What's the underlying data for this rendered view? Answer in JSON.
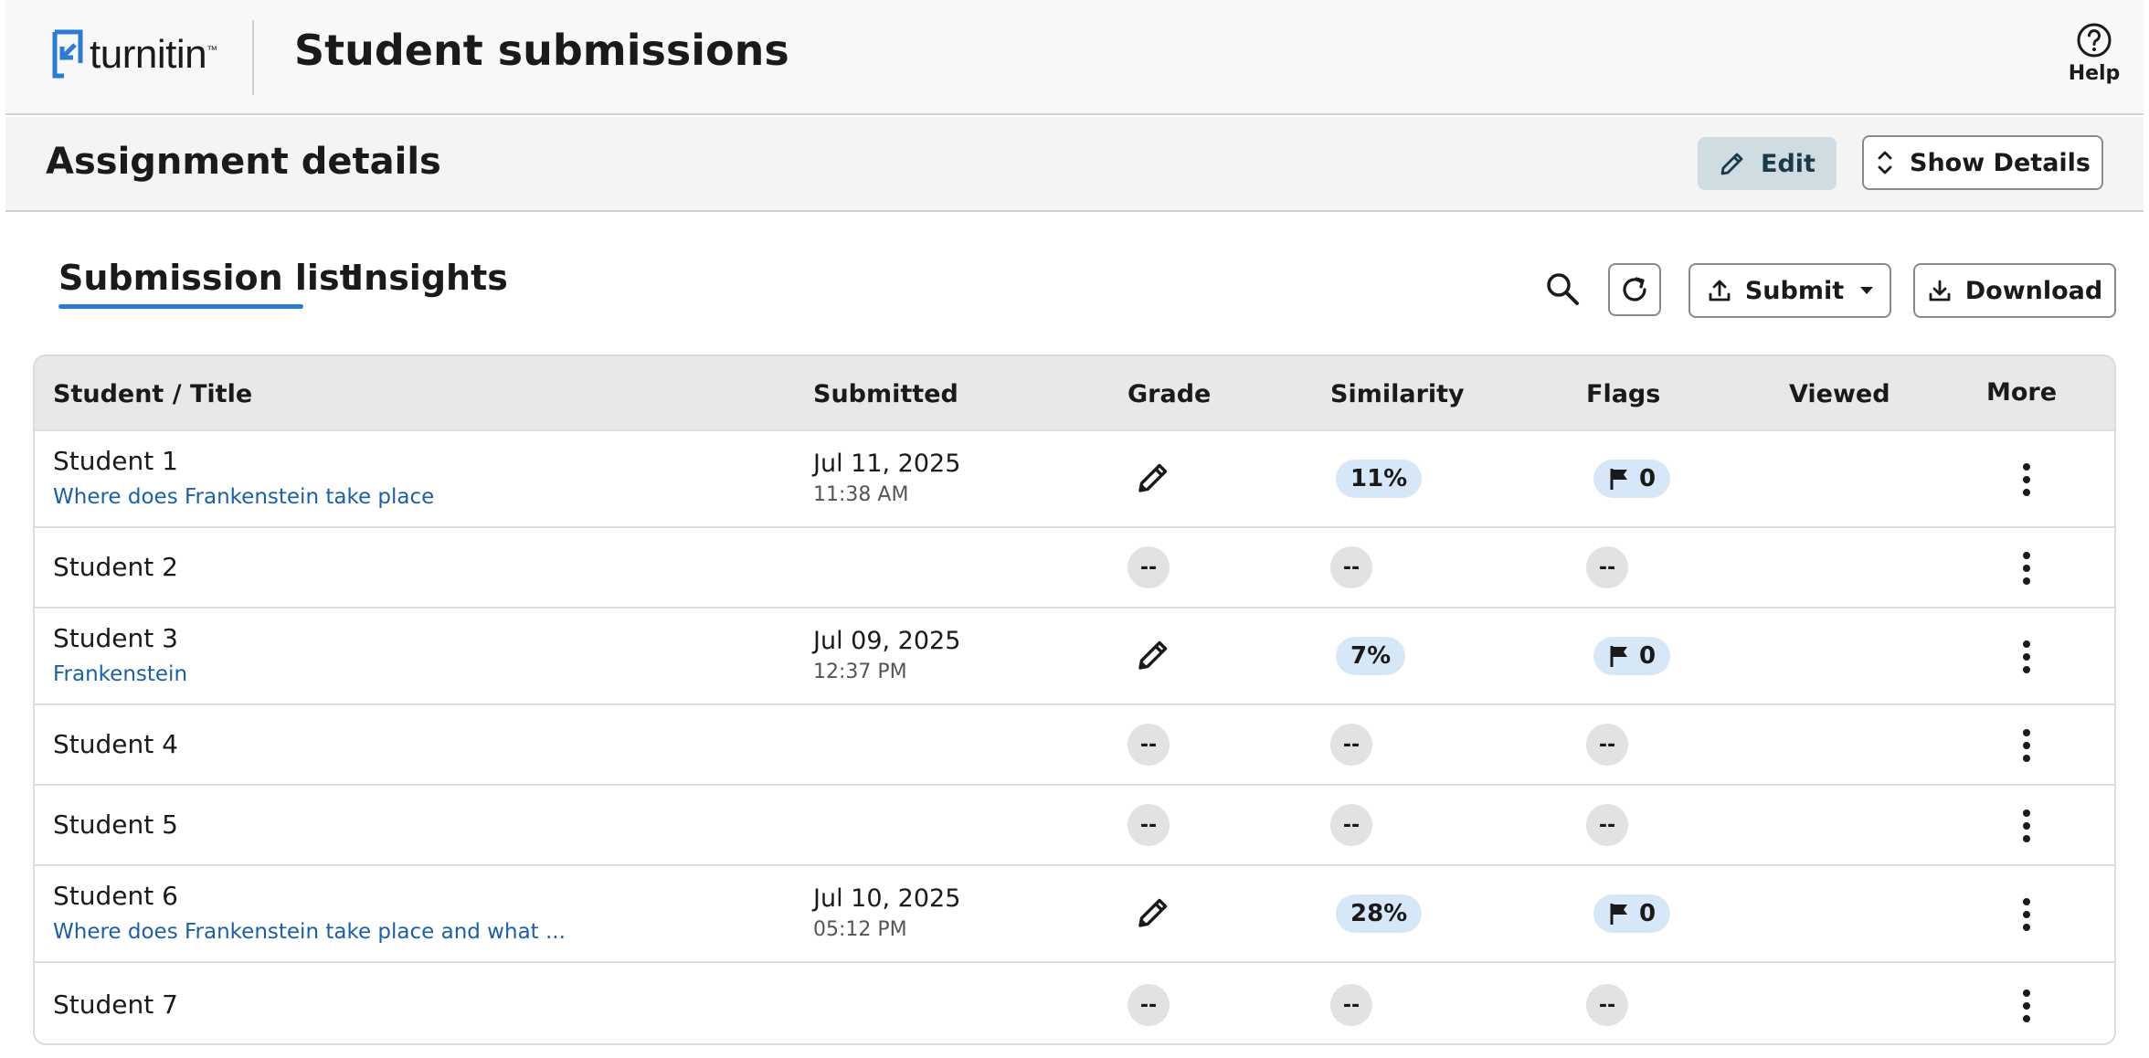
{
  "header": {
    "logo_text": "turnitin",
    "logo_tm": "™",
    "title": "Student submissions",
    "help_label": "Help"
  },
  "assignment": {
    "title": "Assignment details",
    "edit_label": "Edit",
    "show_details_label": "Show Details"
  },
  "tabs": [
    {
      "label": "Submission list",
      "active": true
    },
    {
      "label": "Insights",
      "active": false
    }
  ],
  "toolbar": {
    "submit_label": "Submit",
    "download_label": "Download"
  },
  "table": {
    "columns": [
      "Student / Title",
      "Submitted",
      "Grade",
      "Similarity",
      "Flags",
      "Viewed",
      "More"
    ],
    "empty_placeholder": "--",
    "rows": [
      {
        "student": "Student 1",
        "title": "Where does Frankenstein take place",
        "date": "Jul 11, 2025",
        "time": "11:38 AM",
        "similarity": "11%",
        "flags": "0"
      },
      {
        "student": "Student 2",
        "title": "",
        "date": "",
        "time": "",
        "similarity": "",
        "flags": ""
      },
      {
        "student": "Student 3",
        "title": "Frankenstein",
        "date": "Jul 09, 2025",
        "time": "12:37 PM",
        "similarity": "7%",
        "flags": "0"
      },
      {
        "student": "Student 4",
        "title": "",
        "date": "",
        "time": "",
        "similarity": "",
        "flags": ""
      },
      {
        "student": "Student 5",
        "title": "",
        "date": "",
        "time": "",
        "similarity": "",
        "flags": ""
      },
      {
        "student": "Student 6",
        "title": "Where does Frankenstein take place and what ...",
        "date": "Jul 10, 2025",
        "time": "05:12 PM",
        "similarity": "28%",
        "flags": "0"
      },
      {
        "student": "Student 7",
        "title": "",
        "date": "",
        "time": "",
        "similarity": "",
        "flags": ""
      }
    ]
  },
  "colors": {
    "accent": "#2a7bd6",
    "link": "#1a5fa8",
    "pill_blue": "#d6e7f8",
    "edit_button_bg": "#cfdde3"
  }
}
